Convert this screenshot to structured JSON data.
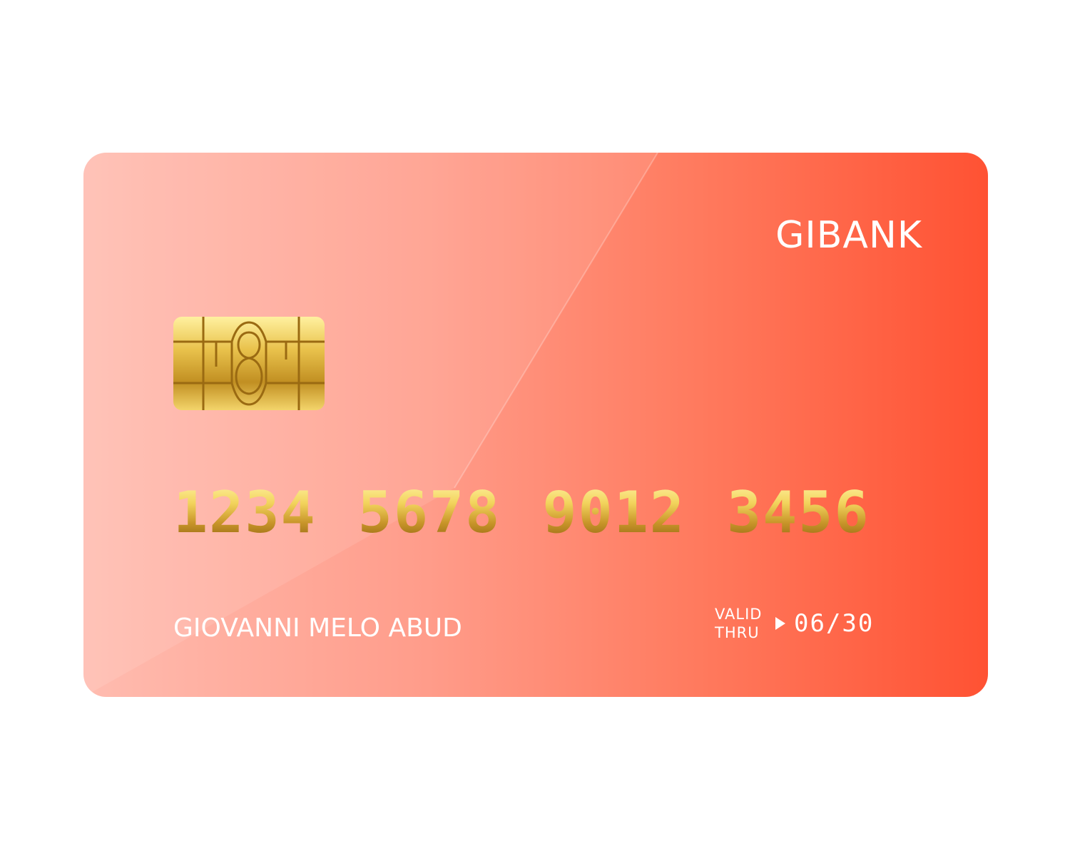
{
  "card": {
    "bank_name": "GIBANK",
    "number_groups": [
      "1234",
      "5678",
      "9012",
      "3456"
    ],
    "holder_name": "GIOVANNI MELO ABUD",
    "valid_label_line1": "VALID",
    "valid_label_line2": "THRU",
    "expiry": "06/30"
  },
  "icons": {
    "chip": "emv-chip-icon",
    "arrow": "triangle-right-icon"
  },
  "colors": {
    "card_gradient_start": "#ffbcb0",
    "card_gradient_end": "#ff5233",
    "gold_light": "#fff3a3",
    "gold_dark": "#8a5d0e",
    "text": "#ffffff"
  }
}
